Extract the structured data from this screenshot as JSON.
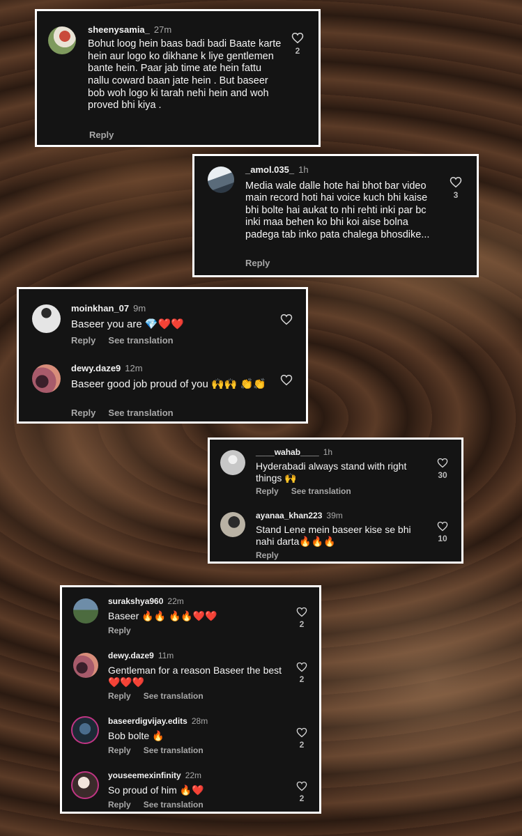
{
  "card1": {
    "comment": {
      "user": "sheenysamia_",
      "time": "27m",
      "text": "Bohut loog hein baas badi badi Baate karte hein aur logo ko dikhane k liye gentlemen bante hein. Paar jab time ate hein fattu nallu coward baan jate hein . But baseer bob woh logo ki tarah nehi hein and woh proved bhi kiya .",
      "reply": "Reply",
      "likes": "2"
    }
  },
  "card2": {
    "comment": {
      "user": "_amol.035_",
      "time": "1h",
      "text": "Media wale dalle hote hai bhot bar video main record hoti hai voice kuch bhi kaise bhi bolte hai aukat to nhi rehti inki par bc inki maa behen ko bhi koi aise bolna padega tab inko pata chalega bhosdike...",
      "reply": "Reply",
      "likes": "3"
    }
  },
  "card3": {
    "comments": [
      {
        "user": "moinkhan_07",
        "time": "9m",
        "text": "Baseer you are 💎❤️❤️",
        "reply": "Reply",
        "translate": "See translation"
      },
      {
        "user": "dewy.daze9",
        "time": "12m",
        "text": "Baseer good job proud of you 🙌🙌 👏👏",
        "reply": "Reply",
        "translate": "See translation"
      }
    ]
  },
  "card4": {
    "comments": [
      {
        "user": "____wahab____",
        "time": "1h",
        "text": "Hyderabadi always stand with right things 🙌",
        "reply": "Reply",
        "translate": "See translation",
        "likes": "30"
      },
      {
        "user": "ayanaa_khan223",
        "time": "39m",
        "text": "Stand Lene mein baseer kise se bhi nahi darta🔥🔥🔥",
        "reply": "Reply",
        "likes": "10"
      }
    ]
  },
  "card5": {
    "comments": [
      {
        "user": "surakshya960",
        "time": "22m",
        "text": "Baseer 🔥🔥 🔥🔥❤️❤️",
        "reply": "Reply",
        "likes": "2"
      },
      {
        "user": "dewy.daze9",
        "time": "11m",
        "text": "Gentleman for a reason Baseer the best ❤️❤️❤️",
        "reply": "Reply",
        "translate": "See translation",
        "likes": "2"
      },
      {
        "user": "baseerdigvijay.edits",
        "time": "28m",
        "text": "Bob bolte 🔥",
        "reply": "Reply",
        "translate": "See translation",
        "likes": "2"
      },
      {
        "user": "youseemexinfinity",
        "time": "22m",
        "text": "So proud of him 🔥❤️",
        "reply": "Reply",
        "translate": "See translation",
        "likes": "2"
      }
    ]
  },
  "icons": {
    "like": "heart-outline-icon",
    "avatar": "user-avatar"
  },
  "colors": {
    "card_bg": "#141414",
    "card_border": "#ffffff",
    "muted": "#a8a8a8"
  }
}
